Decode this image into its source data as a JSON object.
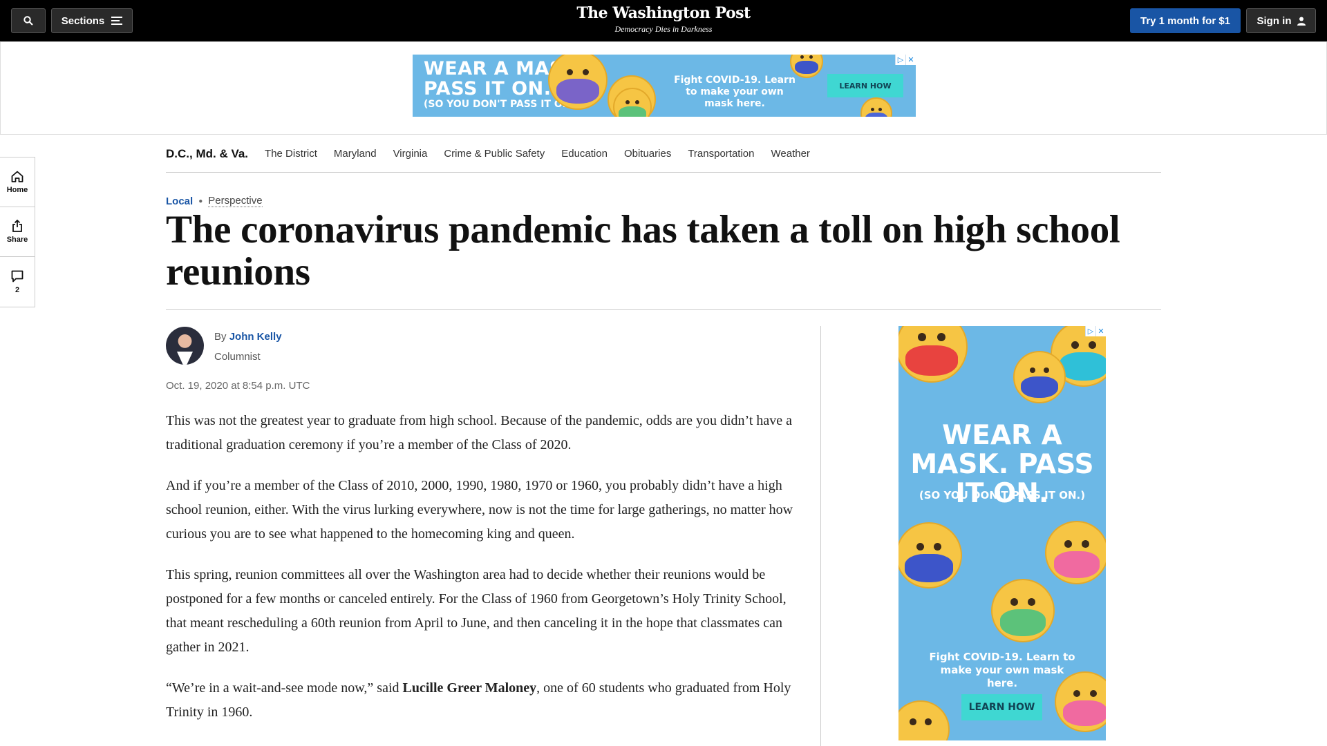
{
  "topbar": {
    "sections_label": "Sections",
    "logo": "The Washington Post",
    "tagline": "Democracy Dies in Darkness",
    "try_label": "Try 1 month for $1",
    "signin_label": "Sign in"
  },
  "banner_ad": {
    "headline_1": "WEAR A MASK.",
    "headline_2": "PASS IT ON.",
    "sub": "(SO YOU DON'T PASS IT ON.)",
    "message": "Fight COVID-19. Learn to make your own mask here.",
    "cta": "LEARN HOW"
  },
  "section_nav": {
    "brand": "D.C., Md. & Va.",
    "items": [
      "The District",
      "Maryland",
      "Virginia",
      "Crime & Public Safety",
      "Education",
      "Obituaries",
      "Transportation",
      "Weather"
    ]
  },
  "rail": {
    "home": "Home",
    "share": "Share",
    "comments_count": "2"
  },
  "article": {
    "kicker_section": "Local",
    "kicker_label": "Perspective",
    "headline": "The coronavirus pandemic has taken a toll on high school reunions",
    "by": "By",
    "author": "John Kelly",
    "role": "Columnist",
    "date": "Oct. 19, 2020 at 8:54 p.m. UTC",
    "p1": "This was not the greatest year to graduate from high school. Because of the pandemic, odds are you didn’t have a traditional graduation ceremony if you’re a member of the Class of 2020.",
    "p2": "And if you’re a member of the Class of 2010, 2000, 1990, 1980, 1970 or 1960, you probably didn’t have a high school reunion, either. With the virus lurking everywhere, now is not the time for large gatherings, no matter how curious you are to see what happened to the homecoming king and queen.",
    "p3": "This spring, reunion committees all over the Washington area had to decide whether their reunions would be postponed for a few months or canceled entirely. For the Class of 1960 from Georgetown’s Holy Trinity School, that meant rescheduling a 60th reunion from April to June, and then canceling it in the hope that classmates can gather in 2021.",
    "p4_pre": "“We’re in a wait-and-see mode now,” said ",
    "p4_name": "Lucille Greer Maloney",
    "p4_post": ", one of 60 students who graduated from Holy Trinity in 1960."
  },
  "side_ad": {
    "headline": "WEAR A MASK. PASS IT ON.",
    "sub": "(SO YOU DON'T PASS IT ON.)",
    "message": "Fight COVID-19. Learn to make your own mask here.",
    "cta": "LEARN HOW"
  },
  "colors": {
    "brand_blue": "#1955a5",
    "ad_blue": "#6cb8e6",
    "ad_cta": "#3fd7d2"
  },
  "icons": [
    "search-icon",
    "menu-icon",
    "user-icon",
    "home-icon",
    "share-icon",
    "comment-icon",
    "adchoices-icon",
    "close-icon"
  ]
}
